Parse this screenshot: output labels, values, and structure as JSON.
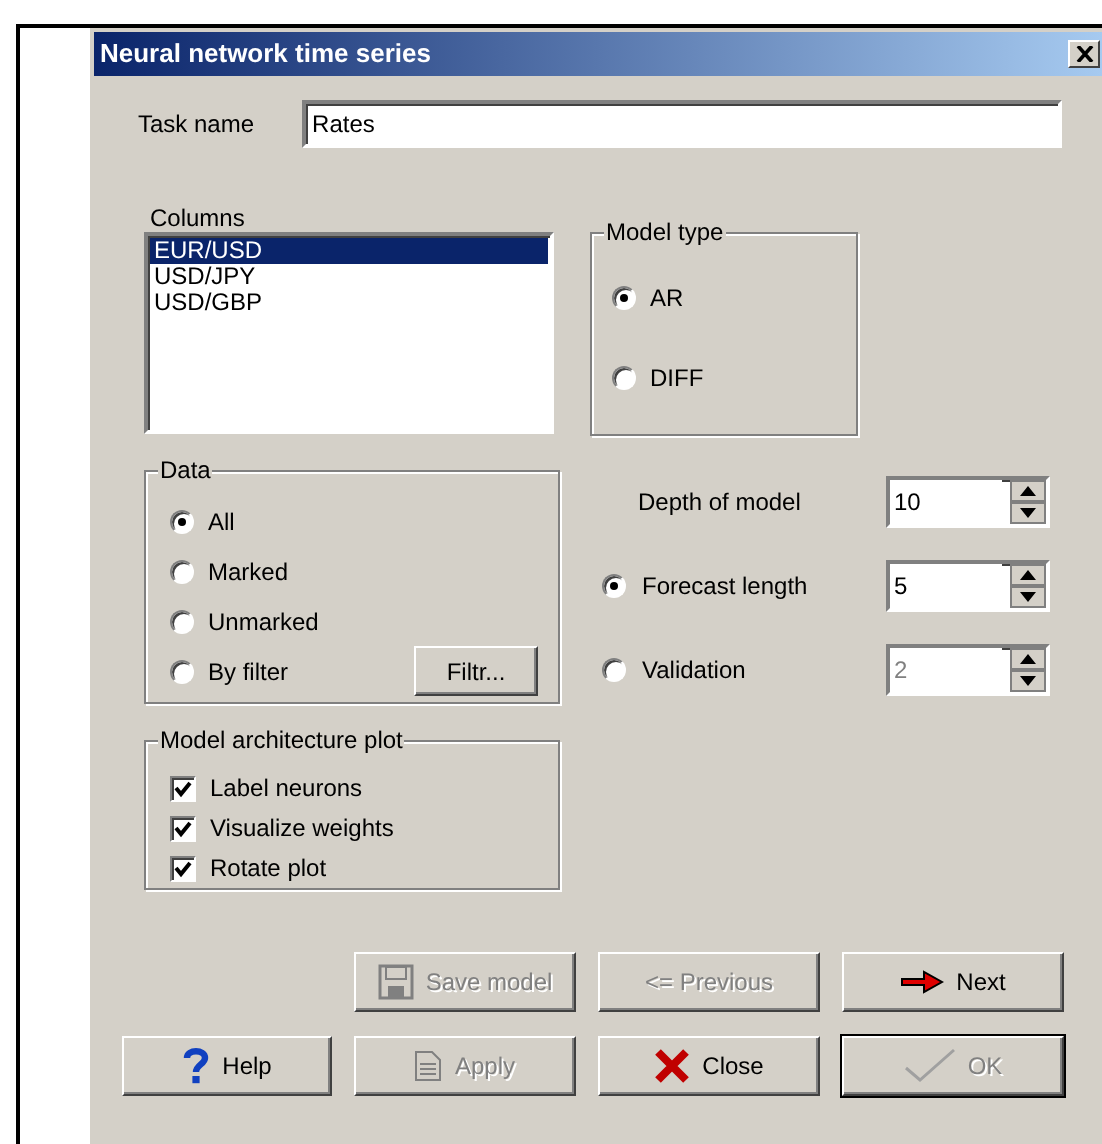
{
  "window": {
    "title": "Neural network time series"
  },
  "task_name": {
    "label": "Task name",
    "value": "Rates"
  },
  "columns": {
    "label": "Columns",
    "items": [
      {
        "label": "EUR/USD",
        "selected": true
      },
      {
        "label": "USD/JPY",
        "selected": false
      },
      {
        "label": "USD/GBP",
        "selected": false
      }
    ]
  },
  "model_type": {
    "title": "Model type",
    "options": [
      {
        "label": "AR",
        "selected": true
      },
      {
        "label": "DIFF",
        "selected": false
      }
    ]
  },
  "data": {
    "title": "Data",
    "filter_button": "Filtr...",
    "options": [
      {
        "label": "All",
        "selected": true
      },
      {
        "label": "Marked",
        "selected": false
      },
      {
        "label": "Unmarked",
        "selected": false
      },
      {
        "label": "By filter",
        "selected": false
      }
    ]
  },
  "parameters": [
    {
      "kind": "spin",
      "label": "Depth of model",
      "value": "10",
      "disabled": false
    },
    {
      "kind": "radio-spin",
      "label": "Forecast length",
      "value": "5",
      "selected": true,
      "disabled": false
    },
    {
      "kind": "radio-spin",
      "label": "Validation",
      "value": "2",
      "selected": false,
      "disabled": true
    }
  ],
  "plot": {
    "title": "Model architecture plot",
    "options": [
      {
        "label": "Label neurons",
        "checked": true
      },
      {
        "label": "Visualize weights",
        "checked": true
      },
      {
        "label": "Rotate plot",
        "checked": true
      }
    ]
  },
  "buttons": [
    {
      "kind": "save",
      "label": "Save model",
      "disabled": true
    },
    {
      "kind": "previous",
      "label": "<= Previous",
      "disabled": true
    },
    {
      "kind": "next",
      "label": "Next",
      "disabled": false
    },
    {
      "kind": "help",
      "label": "Help",
      "disabled": false
    },
    {
      "kind": "apply",
      "label": "Apply",
      "disabled": true
    },
    {
      "kind": "close",
      "label": "Close",
      "disabled": false
    },
    {
      "kind": "ok",
      "label": "OK",
      "disabled": true
    }
  ]
}
